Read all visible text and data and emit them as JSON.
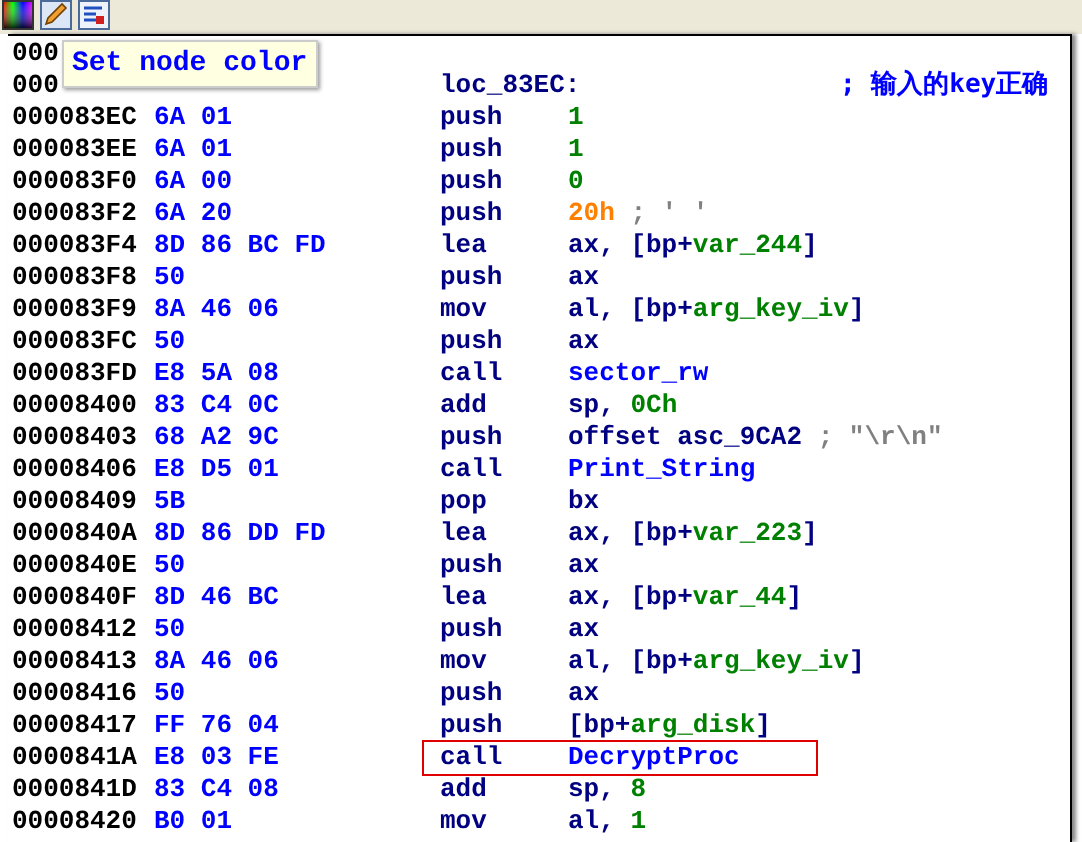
{
  "tooltip": {
    "text": "Set node color"
  },
  "rows": [
    {
      "address": "000",
      "highlighted": false
    },
    {
      "address": "000",
      "label": "loc_83EC:",
      "comment": "; 输入的key正确",
      "highlighted": false
    },
    {
      "address": "000083EC",
      "bytes": "6A 01",
      "mnemonic": "push",
      "operand": [
        {
          "text": "1",
          "kind": "number"
        }
      ],
      "highlighted": false
    },
    {
      "address": "000083EE",
      "bytes": "6A 01",
      "mnemonic": "push",
      "operand": [
        {
          "text": "1",
          "kind": "number"
        }
      ],
      "highlighted": false
    },
    {
      "address": "000083F0",
      "bytes": "6A 00",
      "mnemonic": "push",
      "operand": [
        {
          "text": "0",
          "kind": "number"
        }
      ],
      "highlighted": false
    },
    {
      "address": "000083F2",
      "bytes": "6A 20",
      "mnemonic": "push",
      "operand": [
        {
          "text": "20h",
          "kind": "char"
        },
        {
          "text": " ; ' '",
          "kind": "comment"
        }
      ],
      "highlighted": false
    },
    {
      "address": "000083F4",
      "bytes": "8D 86 BC FD",
      "mnemonic": "lea",
      "operand": [
        {
          "text": "ax, [bp+",
          "kind": "plain"
        },
        {
          "text": "var_244",
          "kind": "var"
        },
        {
          "text": "]",
          "kind": "plain"
        }
      ],
      "highlighted": false
    },
    {
      "address": "000083F8",
      "bytes": "50",
      "mnemonic": "push",
      "operand": [
        {
          "text": "ax",
          "kind": "plain"
        }
      ],
      "highlighted": false
    },
    {
      "address": "000083F9",
      "bytes": "8A 46 06",
      "mnemonic": "mov",
      "operand": [
        {
          "text": "al, [bp+",
          "kind": "plain"
        },
        {
          "text": "arg_key_iv",
          "kind": "var"
        },
        {
          "text": "]",
          "kind": "plain"
        }
      ],
      "highlighted": false
    },
    {
      "address": "000083FC",
      "bytes": "50",
      "mnemonic": "push",
      "operand": [
        {
          "text": "ax",
          "kind": "plain"
        }
      ],
      "highlighted": false
    },
    {
      "address": "000083FD",
      "bytes": "E8 5A 08",
      "mnemonic": "call",
      "operand": [
        {
          "text": "sector_rw",
          "kind": "name"
        }
      ],
      "highlighted": false
    },
    {
      "address": "00008400",
      "bytes": "83 C4 0C",
      "mnemonic": "add",
      "operand": [
        {
          "text": "sp, ",
          "kind": "plain"
        },
        {
          "text": "0Ch",
          "kind": "number"
        }
      ],
      "highlighted": false
    },
    {
      "address": "00008403",
      "bytes": "68 A2 9C",
      "mnemonic": "push",
      "operand": [
        {
          "text": "offset asc_9CA2",
          "kind": "plain"
        },
        {
          "text": " ; \"\\r\\n\"",
          "kind": "comment"
        }
      ],
      "highlighted": false
    },
    {
      "address": "00008406",
      "bytes": "E8 D5 01",
      "mnemonic": "call",
      "operand": [
        {
          "text": "Print_String",
          "kind": "name"
        }
      ],
      "highlighted": false
    },
    {
      "address": "00008409",
      "bytes": "5B",
      "mnemonic": "pop",
      "operand": [
        {
          "text": "bx",
          "kind": "plain"
        }
      ],
      "highlighted": false
    },
    {
      "address": "0000840A",
      "bytes": "8D 86 DD FD",
      "mnemonic": "lea",
      "operand": [
        {
          "text": "ax, [bp+",
          "kind": "plain"
        },
        {
          "text": "var_223",
          "kind": "var"
        },
        {
          "text": "]",
          "kind": "plain"
        }
      ],
      "highlighted": false
    },
    {
      "address": "0000840E",
      "bytes": "50",
      "mnemonic": "push",
      "operand": [
        {
          "text": "ax",
          "kind": "plain"
        }
      ],
      "highlighted": false
    },
    {
      "address": "0000840F",
      "bytes": "8D 46 BC",
      "mnemonic": "lea",
      "operand": [
        {
          "text": "ax, [bp+",
          "kind": "plain"
        },
        {
          "text": "var_44",
          "kind": "var"
        },
        {
          "text": "]",
          "kind": "plain"
        }
      ],
      "highlighted": false
    },
    {
      "address": "00008412",
      "bytes": "50",
      "mnemonic": "push",
      "operand": [
        {
          "text": "ax",
          "kind": "plain"
        }
      ],
      "highlighted": false
    },
    {
      "address": "00008413",
      "bytes": "8A 46 06",
      "mnemonic": "mov",
      "operand": [
        {
          "text": "al, [bp+",
          "kind": "plain"
        },
        {
          "text": "arg_key_iv",
          "kind": "var"
        },
        {
          "text": "]",
          "kind": "plain"
        }
      ],
      "highlighted": false
    },
    {
      "address": "00008416",
      "bytes": "50",
      "mnemonic": "push",
      "operand": [
        {
          "text": "ax",
          "kind": "plain"
        }
      ],
      "highlighted": false
    },
    {
      "address": "00008417",
      "bytes": "FF 76 04",
      "mnemonic": "push",
      "operand": [
        {
          "text": "[bp+",
          "kind": "plain"
        },
        {
          "text": "arg_disk",
          "kind": "var"
        },
        {
          "text": "]",
          "kind": "plain"
        }
      ],
      "highlighted": false
    },
    {
      "address": "0000841A",
      "bytes": "E8 03 FE",
      "mnemonic": "call",
      "operand": [
        {
          "text": "DecryptProc",
          "kind": "name"
        }
      ],
      "highlighted": true
    },
    {
      "address": "0000841D",
      "bytes": "83 C4 08",
      "mnemonic": "add",
      "operand": [
        {
          "text": "sp, ",
          "kind": "plain"
        },
        {
          "text": "8",
          "kind": "number"
        }
      ],
      "highlighted": false
    },
    {
      "address": "00008420",
      "bytes": "B0 01",
      "mnemonic": "mov",
      "operand": [
        {
          "text": "al, ",
          "kind": "plain"
        },
        {
          "text": "1",
          "kind": "number"
        }
      ],
      "highlighted": false
    }
  ]
}
